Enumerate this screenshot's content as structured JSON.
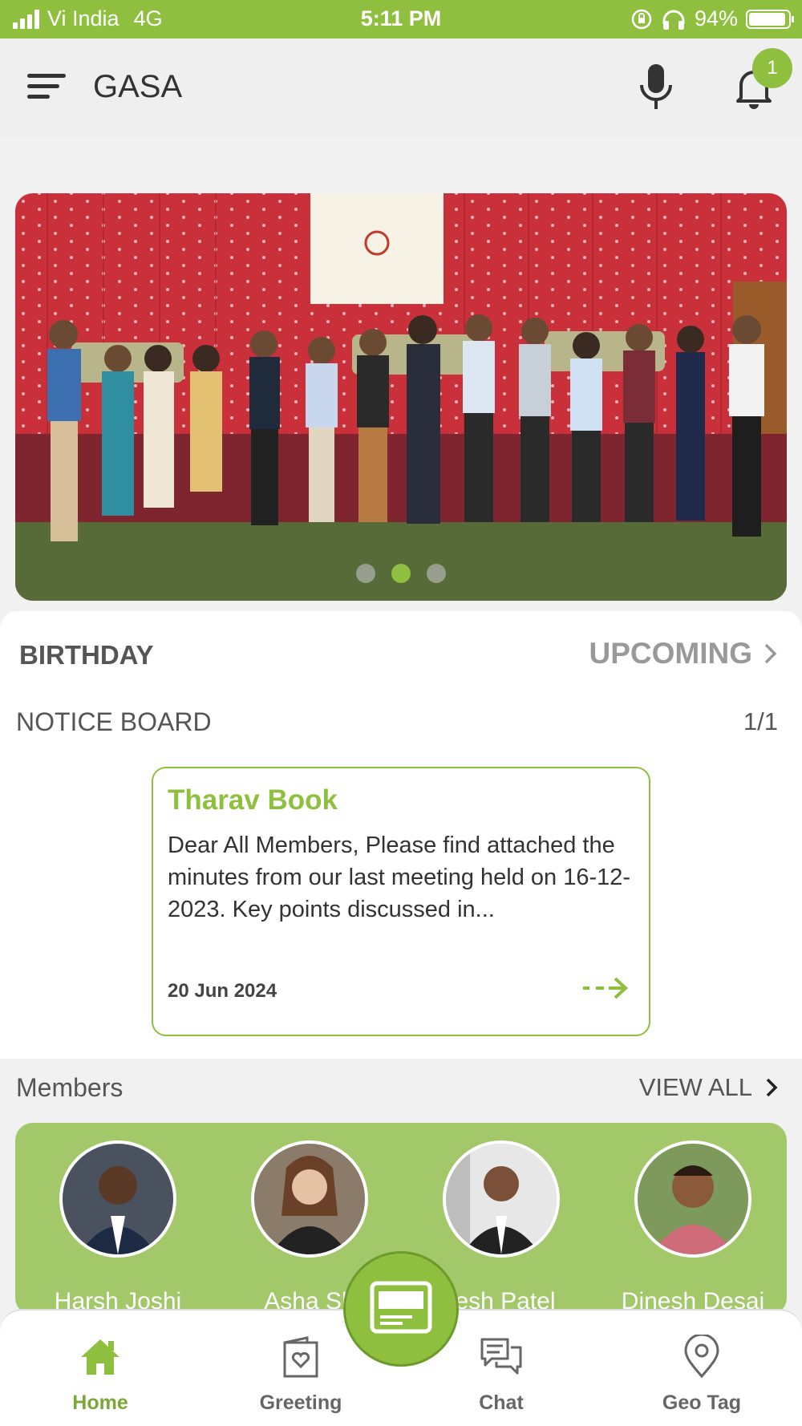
{
  "status_bar": {
    "carrier": "Vi India",
    "network": "4G",
    "time": "5:11 PM",
    "battery": "94%",
    "battery_level": 0.94
  },
  "app_bar": {
    "title": "GASA",
    "notification_count": "1"
  },
  "banner": {
    "slide_count": 3,
    "active_slide": 1
  },
  "birthday": {
    "label": "BIRTHDAY",
    "upcoming_label": "UPCOMING"
  },
  "notice_board": {
    "title": "NOTICE BOARD",
    "count": "1/1",
    "notice": {
      "title": "Tharav Book",
      "body": "Dear All Members, Please find attached the minutes from our last meeting held on 16-12-2023. Key points discussed in...",
      "date": "20 Jun 2024"
    }
  },
  "members": {
    "title": "Members",
    "view_all_label": "VIEW ALL",
    "list": [
      {
        "name": "Harsh  Joshi"
      },
      {
        "name": "Asha  Sh"
      },
      {
        "name": "resh  Patel"
      },
      {
        "name": "Dinesh  Desai"
      }
    ]
  },
  "bottom_nav": {
    "items": [
      {
        "label": "Home",
        "icon": "home-icon"
      },
      {
        "label": "Greeting",
        "icon": "greeting-card-icon"
      },
      {
        "label": "Chat",
        "icon": "chat-icon"
      },
      {
        "label": "Geo Tag",
        "icon": "location-pin-icon"
      }
    ],
    "center_button_icon": "id-card-icon"
  },
  "colors": {
    "accent": "#8fbf3f",
    "members_bg": "#a2c86a"
  }
}
